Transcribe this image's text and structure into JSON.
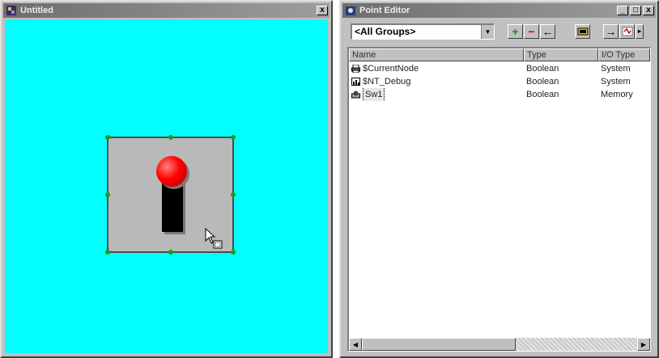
{
  "left_window": {
    "title": "Untitled",
    "close_label": "x"
  },
  "right_window": {
    "title": "Point Editor",
    "minimize_label": "_",
    "maximize_label": "□",
    "close_label": "x",
    "group_select": {
      "value": "<All Groups>"
    },
    "toolbar": {
      "add_label": "+",
      "remove_label": "−",
      "back_label": "←",
      "forward_label": "→"
    },
    "table": {
      "columns": [
        "Name",
        "Type",
        "I/O Type"
      ],
      "rows": [
        {
          "icon": "printer-icon",
          "name": "$CurrentNode",
          "type": "Boolean",
          "io_type": "System"
        },
        {
          "icon": "chart-icon",
          "name": "$NT_Debug",
          "type": "Boolean",
          "io_type": "System"
        },
        {
          "icon": "switch-point-icon",
          "name": "Sw1",
          "type": "Boolean",
          "io_type": "Memory"
        }
      ]
    }
  },
  "colors": {
    "canvas_bg": "#00ffff",
    "widget_bg": "#b9b9b9",
    "knob": "#ff0000",
    "selection_handle": "#1e9a1e",
    "titlebar_inactive": "#808080"
  }
}
